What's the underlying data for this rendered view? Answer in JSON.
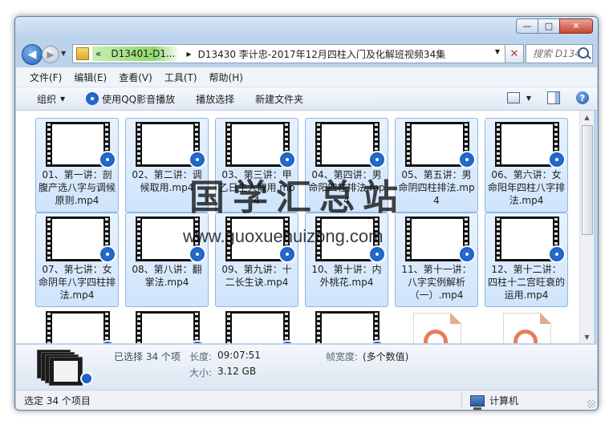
{
  "window": {
    "caption_buttons": {
      "minimize": "—",
      "maximize": "□",
      "close": "✕"
    }
  },
  "nav": {
    "back_glyph": "◀",
    "forward_glyph": "▶",
    "breadcrumb": {
      "overflow": "«",
      "root": "D13401-D1...",
      "separator": "▶",
      "current": "D13430 李计忠-2017年12月四柱入门及化解班视频34集"
    },
    "clear_glyph": "✕",
    "search": {
      "placeholder": "搜索 D134..."
    }
  },
  "menu": [
    "文件(F)",
    "编辑(E)",
    "查看(V)",
    "工具(T)",
    "帮助(H)"
  ],
  "toolbar": {
    "organize": "组织",
    "play_qq": "使用QQ影音播放",
    "play_select": "播放选择",
    "new_folder": "新建文件夹",
    "help_glyph": "?"
  },
  "files": [
    {
      "name": "01、第一讲：剖腹产选八字与调候原则.mp4",
      "type": "video"
    },
    {
      "name": "02、第二讲：调候取用.mp4",
      "type": "video"
    },
    {
      "name": "03、第三讲：甲乙日主人取用.mp4",
      "type": "video"
    },
    {
      "name": "04、第四讲：男命阳四柱排法.mp4",
      "type": "video"
    },
    {
      "name": "05、第五讲：男命阴四柱排法.mp4",
      "type": "video"
    },
    {
      "name": "06、第六讲：女命阳年四柱八字排法.mp4",
      "type": "video"
    },
    {
      "name": "07、第七讲：女命阴年八字四柱排法.mp4",
      "type": "video"
    },
    {
      "name": "08、第八讲：翻掌法.mp4",
      "type": "video"
    },
    {
      "name": "09、第九讲：十二长生诀.mp4",
      "type": "video"
    },
    {
      "name": "10、第十讲：内外桃花.mp4",
      "type": "video"
    },
    {
      "name": "11、第十一讲：八字实例解析（一）.mp4",
      "type": "video"
    },
    {
      "name": "12、第十二讲：四柱十二宫旺衰的运用.mp4",
      "type": "video"
    },
    {
      "name": "",
      "type": "video"
    },
    {
      "name": "",
      "type": "video"
    },
    {
      "name": "",
      "type": "video"
    },
    {
      "name": "",
      "type": "video"
    },
    {
      "name": "",
      "type": "media"
    },
    {
      "name": "",
      "type": "media"
    }
  ],
  "details": {
    "selected": "已选择 34 个项",
    "length_label": "长度:",
    "length_value": "09:07:51",
    "size_label": "大小:",
    "size_value": "3.12 GB",
    "frame_width_label": "帧宽度:",
    "frame_width_value": "(多个数值)"
  },
  "status": {
    "left": "选定 34 个项目",
    "right": "计算机"
  },
  "watermark": {
    "text": "国学汇总站",
    "url": "www.guoxuehuizong.com"
  },
  "colors": {
    "accent_blue": "#1f64c8",
    "selection_bg": "#cfe4fb",
    "breadcrumb_highlight": "#8fd86a",
    "close_red": "#c7462f"
  }
}
